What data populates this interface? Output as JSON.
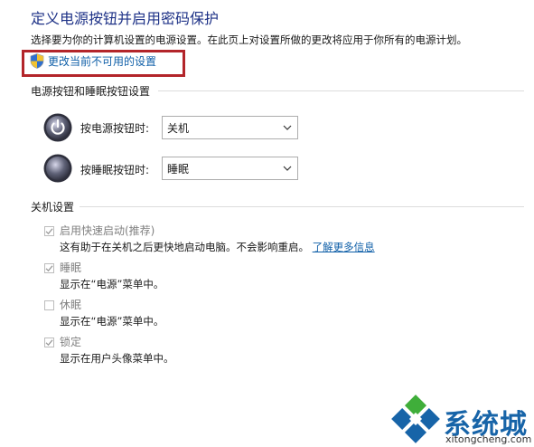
{
  "page": {
    "title": "定义电源按钮并启用密码保护",
    "description": "选择要为你的计算机设置的电源设置。在此页上对设置所做的更改将应用于你所有的电源计划。",
    "change_unavailable_link": "更改当前不可用的设置"
  },
  "power_buttons_section": {
    "heading": "电源按钮和睡眠按钮设置",
    "rows": [
      {
        "label": "按电源按钮时:",
        "value": "关机",
        "icon": "power-button-icon"
      },
      {
        "label": "按睡眠按钮时:",
        "value": "睡眠",
        "icon": "sleep-button-icon"
      }
    ]
  },
  "shutdown_section": {
    "heading": "关机设置",
    "options": [
      {
        "label": "启用快速启动(推荐)",
        "checked": true,
        "desc": "这有助于在关机之后更快地启动电脑。不会影响重启。",
        "link": "了解更多信息"
      },
      {
        "label": "睡眠",
        "checked": true,
        "desc": "显示在“电源”菜单中。"
      },
      {
        "label": "休眠",
        "checked": false,
        "desc": "显示在“电源”菜单中。"
      },
      {
        "label": "锁定",
        "checked": true,
        "desc": "显示在用户头像菜单中。"
      }
    ]
  },
  "watermark": {
    "text": "系统城",
    "url": "xitongcheng.com",
    "colors": {
      "blue": "#1764a8",
      "green": "#3fae3a"
    }
  },
  "colors": {
    "title": "#1e3287",
    "link": "#0f5fa8",
    "highlight": "#b3252a",
    "disabled_text": "#808080"
  }
}
